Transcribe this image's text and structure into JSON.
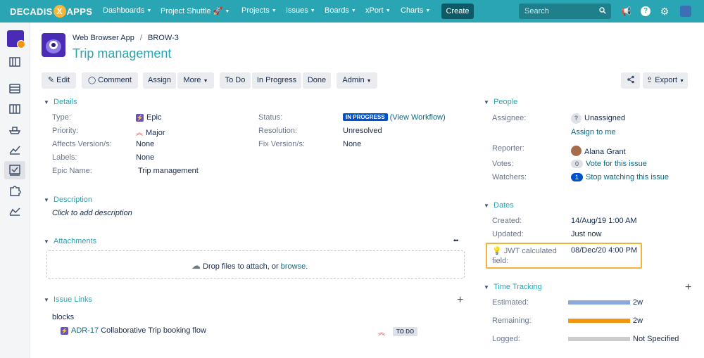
{
  "topnav": {
    "logo_left": "DECADIS",
    "logo_x": "X",
    "logo_right": "APPS",
    "items": [
      "Dashboards",
      "Project Shuttle",
      "Projects",
      "Issues",
      "Boards",
      "xPort",
      "Charts"
    ],
    "create_label": "Create",
    "search_placeholder": "Search"
  },
  "breadcrumb": {
    "project": "Web Browser App",
    "separator": "/",
    "issue_key": "BROW-3"
  },
  "title": "Trip management",
  "toolbar": {
    "edit": "Edit",
    "comment": "Comment",
    "assign": "Assign",
    "more": "More",
    "todo": "To Do",
    "in_progress": "In Progress",
    "done": "Done",
    "admin": "Admin",
    "export": "Export"
  },
  "details": {
    "heading": "Details",
    "type_label": "Type:",
    "type_value": "Epic",
    "priority_label": "Priority:",
    "priority_value": "Major",
    "affects_label": "Affects Version/s:",
    "affects_value": "None",
    "labels_label": "Labels:",
    "labels_value": "None",
    "epic_name_label": "Epic Name:",
    "epic_name_value": "Trip management",
    "status_label": "Status:",
    "status_value": "IN PROGRESS",
    "status_link": "(View Workflow)",
    "resolution_label": "Resolution:",
    "resolution_value": "Unresolved",
    "fix_label": "Fix Version/s:",
    "fix_value": "None"
  },
  "description": {
    "heading": "Description",
    "placeholder": "Click to add description"
  },
  "attachments": {
    "heading": "Attachments",
    "drop_text": "Drop files to attach, or",
    "browse": "browse.",
    "more": "•••"
  },
  "issue_links": {
    "heading": "Issue Links",
    "add": "+",
    "group": "blocks",
    "items": [
      {
        "key": "ADR-17",
        "summary": "Collaborative Trip booking flow",
        "status": "TO DO"
      }
    ]
  },
  "people": {
    "heading": "People",
    "assignee_label": "Assignee:",
    "assignee_value": "Unassigned",
    "assign_to_me": "Assign to me",
    "reporter_label": "Reporter:",
    "reporter_value": "Alana Grant",
    "votes_label": "Votes:",
    "votes_count": "0",
    "votes_link": "Vote for this issue",
    "watchers_label": "Watchers:",
    "watchers_count": "1",
    "watchers_link": "Stop watching this issue"
  },
  "dates": {
    "heading": "Dates",
    "created_label": "Created:",
    "created_value": "14/Aug/19 1:00 AM",
    "updated_label": "Updated:",
    "updated_value": "Just now",
    "jwt_label_1": "JWT calculated",
    "jwt_label_2": "field:",
    "jwt_value": "08/Dec/20 4:00 PM"
  },
  "time_tracking": {
    "heading": "Time Tracking",
    "add": "+",
    "estimated_label": "Estimated:",
    "estimated_value": "2w",
    "remaining_label": "Remaining:",
    "remaining_value": "2w",
    "logged_label": "Logged:",
    "logged_value": "Not Specified"
  },
  "colors": {
    "accent": "#2aa5b3",
    "estimated": "#8aa8da",
    "remaining": "#f2960f",
    "logged": "#cccccc",
    "highlight": "#f2b33d"
  }
}
